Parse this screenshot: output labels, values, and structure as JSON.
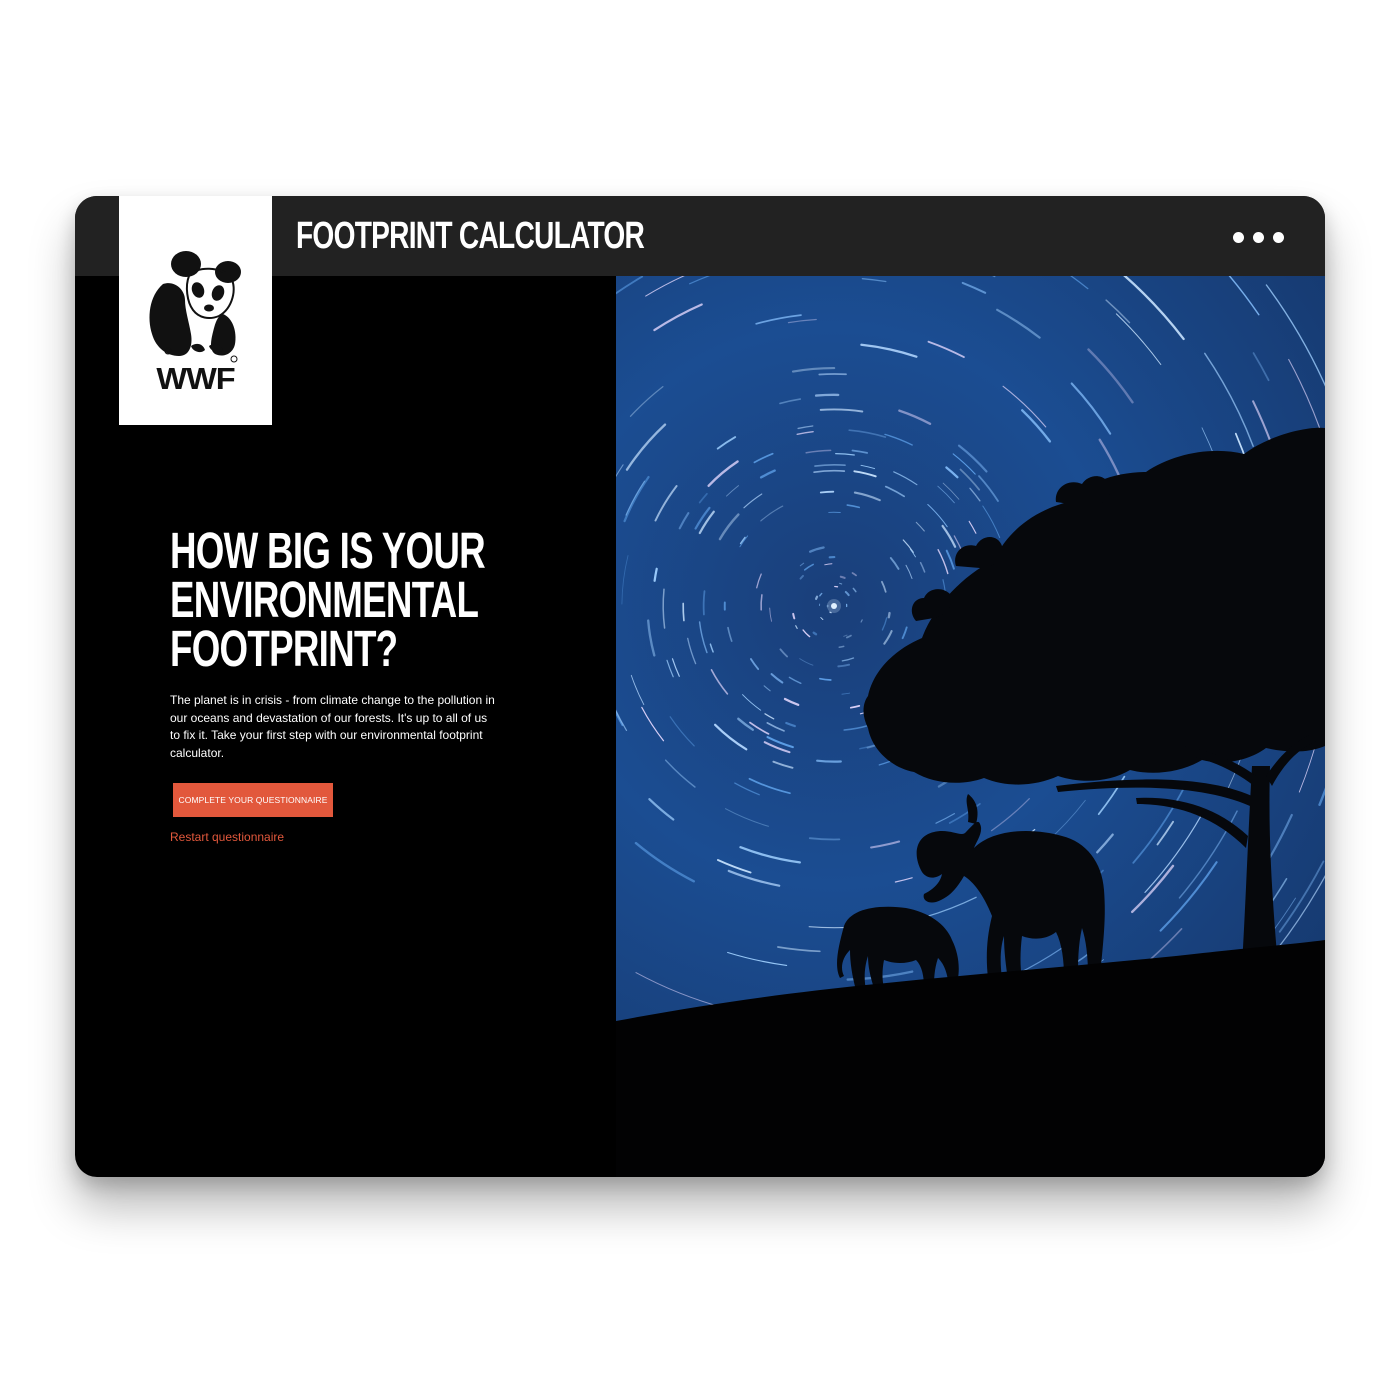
{
  "header": {
    "title": "FOOTPRINT CALCULATOR",
    "menu_icon": "more-horizontal-icon"
  },
  "logo": {
    "text": "WWF",
    "icon": "panda-icon"
  },
  "hero": {
    "headline_lines": [
      "HOW BIG IS YOUR",
      "ENVIRONMENTAL",
      "FOOTPRINT?"
    ],
    "intro": "The planet is in crisis - from climate change to the pollution in our oceans and devastation of our forests. It's up to all of us to fix it. Take your first step with our environmental footprint calculator.",
    "cta_label": "COMPLETE YOUR QUESTIONNAIRE",
    "restart_label": "Restart questionnaire",
    "image_subject": "star-trails-elephants-tree-image"
  },
  "colors": {
    "accent": "#e2583c",
    "topbar": "#222222",
    "background": "#000000",
    "sky": "#1d4f95"
  }
}
